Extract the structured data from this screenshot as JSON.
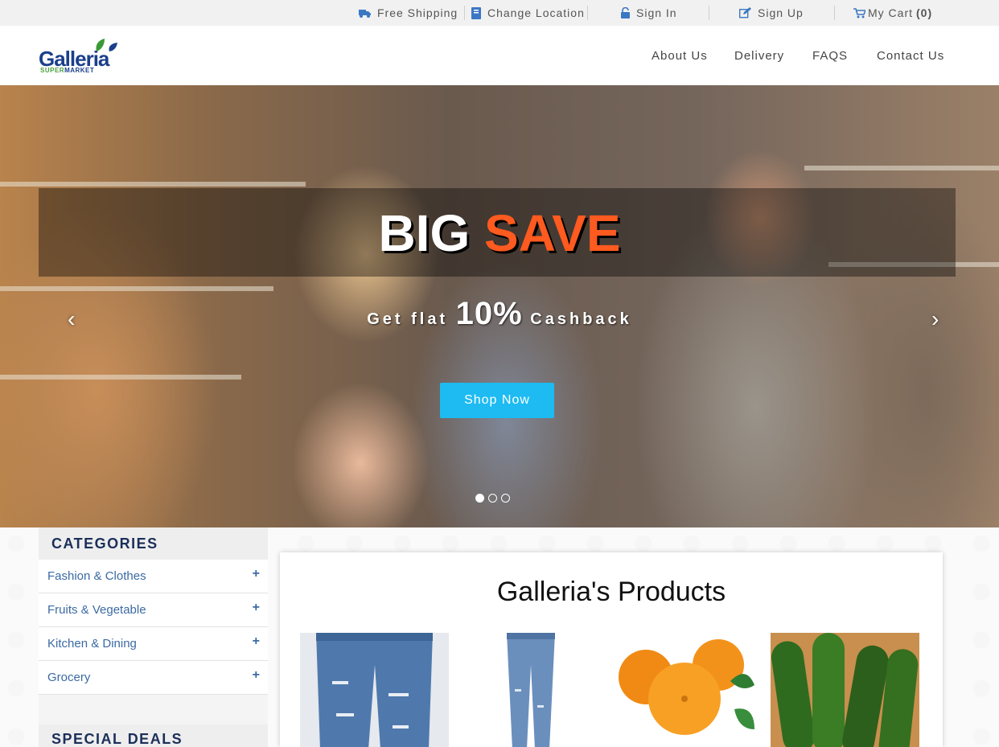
{
  "topbar": {
    "free_shipping": "Free Shipping",
    "change_location": "Change Location",
    "sign_in": "Sign In",
    "sign_up": "Sign Up",
    "my_cart": "My Cart",
    "cart_count": "(0)"
  },
  "logo": {
    "name": "Galleria",
    "sub_a": "SUPER",
    "sub_b": "MARKET"
  },
  "nav": {
    "about": "About Us",
    "delivery": "Delivery",
    "faqs": "FAQS",
    "contact": "Contact Us"
  },
  "hero": {
    "title_a": "BIG",
    "title_b": "SAVE",
    "sub_a": "Get flat",
    "sub_big": "10%",
    "sub_b": "Cashback",
    "button": "Shop Now",
    "prev": "‹",
    "next": "›",
    "slides_active": 1
  },
  "categories": {
    "title": "CATEGORIES",
    "items": [
      {
        "label": "Fashion & Clothes",
        "plus": "+"
      },
      {
        "label": "Fruits & Vegetable",
        "plus": "+"
      },
      {
        "label": "Kitchen & Dining",
        "plus": "+"
      },
      {
        "label": "Grocery",
        "plus": "+"
      }
    ]
  },
  "deals": {
    "title": "SPECIAL DEALS"
  },
  "products": {
    "title": "Galleria's Products"
  },
  "colors": {
    "accent": "#1dbbf2",
    "save": "#ff5a1f",
    "brand": "#1b3f8b",
    "link": "#3b6aa3"
  }
}
